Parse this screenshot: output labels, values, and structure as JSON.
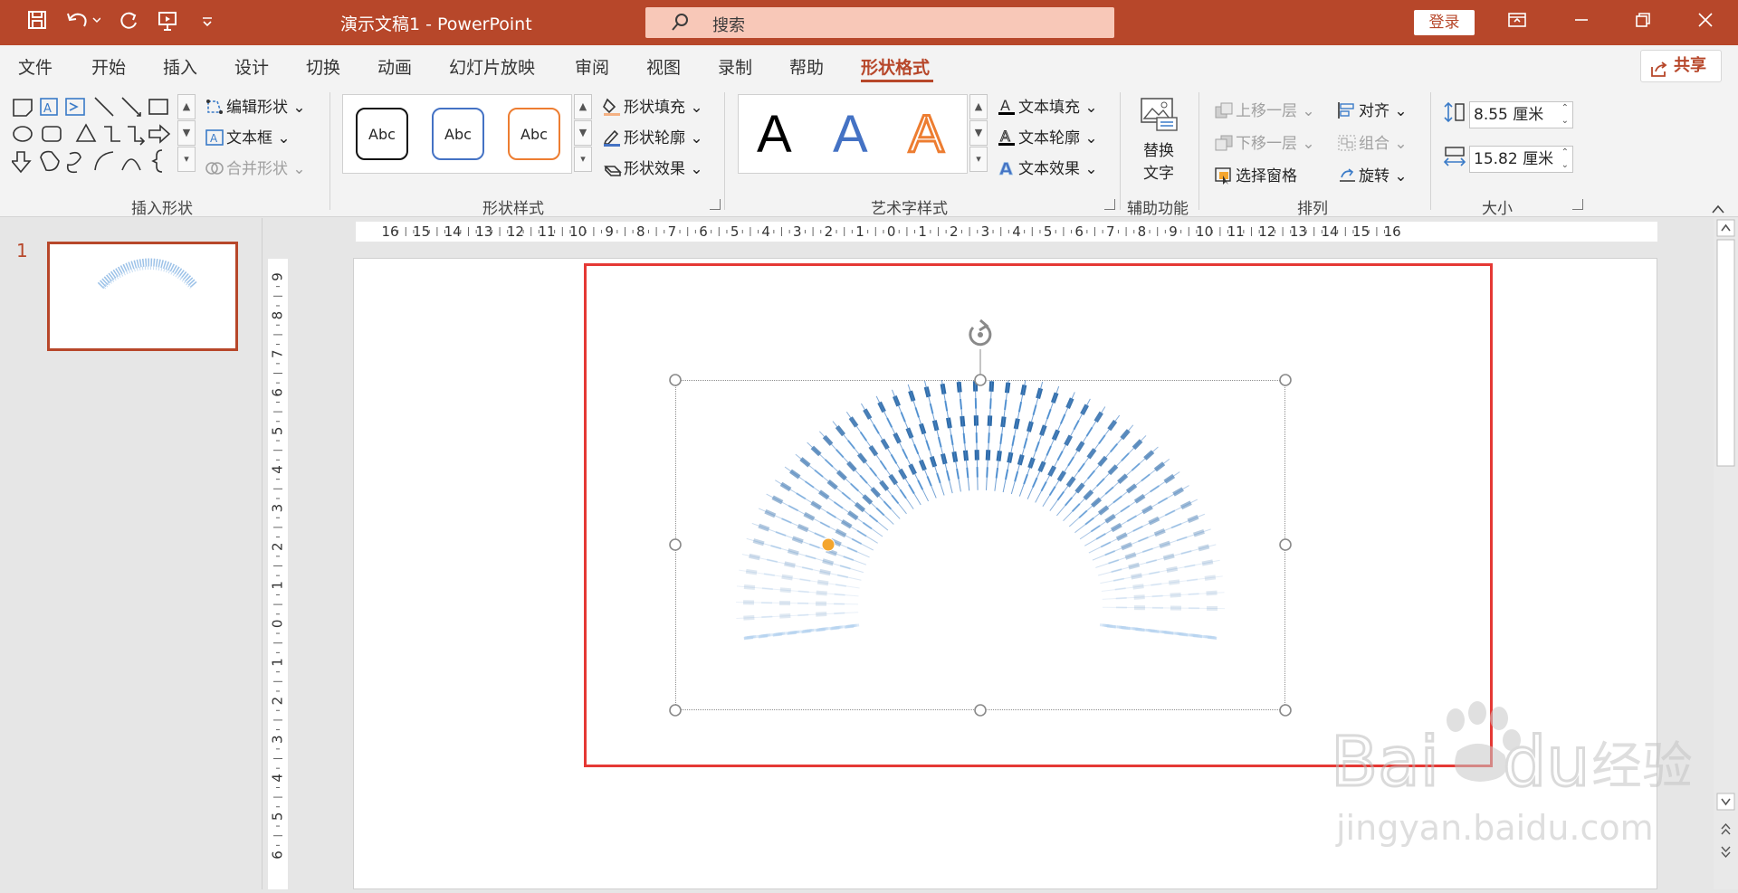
{
  "titlebar": {
    "title": "演示文稿1  -  PowerPoint",
    "search_placeholder": "搜索",
    "login_label": "登录"
  },
  "tabs": {
    "items": [
      "文件",
      "开始",
      "插入",
      "设计",
      "切换",
      "动画",
      "幻灯片放映",
      "审阅",
      "视图",
      "录制",
      "帮助",
      "形状格式"
    ],
    "active": "形状格式",
    "share_label": "共享"
  },
  "ribbon": {
    "insert_shapes": {
      "label": "插入形状",
      "edit_shape": "编辑形状",
      "text_box": "文本框",
      "merge_shapes": "合并形状"
    },
    "shape_styles": {
      "label": "形状样式",
      "samples": [
        "Abc",
        "Abc",
        "Abc"
      ],
      "fill": "形状填充",
      "outline": "形状轮廓",
      "effects": "形状效果"
    },
    "wordart_styles": {
      "label": "艺术字样式",
      "samples": [
        "A",
        "A",
        "A"
      ],
      "text_fill": "文本填充",
      "text_outline": "文本轮廓",
      "text_effects": "文本效果"
    },
    "accessibility": {
      "label": "辅助功能",
      "alt_text_line1": "替换",
      "alt_text_line2": "文字"
    },
    "arrange": {
      "label": "排列",
      "bring_forward": "上移一层",
      "send_backward": "下移一层",
      "selection_pane": "选择窗格",
      "align": "对齐",
      "group": "组合",
      "rotate": "旋转"
    },
    "size": {
      "label": "大小",
      "height": "8.55 厘米",
      "width": "15.82 厘米"
    }
  },
  "slides": {
    "current_number": "1"
  },
  "rulers": {
    "horizontal": [
      "16",
      "15",
      "14",
      "13",
      "12",
      "11",
      "10",
      "9",
      "8",
      "7",
      "6",
      "5",
      "4",
      "3",
      "2",
      "1",
      "0",
      "1",
      "2",
      "3",
      "4",
      "5",
      "6",
      "7",
      "8",
      "9",
      "10",
      "11",
      "12",
      "13",
      "14",
      "15",
      "16"
    ],
    "vertical": [
      "9",
      "8",
      "7",
      "6",
      "5",
      "4",
      "3",
      "2",
      "1",
      "0",
      "1",
      "2",
      "3",
      "4",
      "5",
      "6"
    ]
  },
  "watermark": {
    "line1": "Bai",
    "line2": "du",
    "line3": "经验",
    "url": "jingyan.baidu.com"
  },
  "colors": {
    "accent": "#b7472a",
    "highlight_box": "#e53935",
    "shape_blue": "#4a86c8"
  }
}
